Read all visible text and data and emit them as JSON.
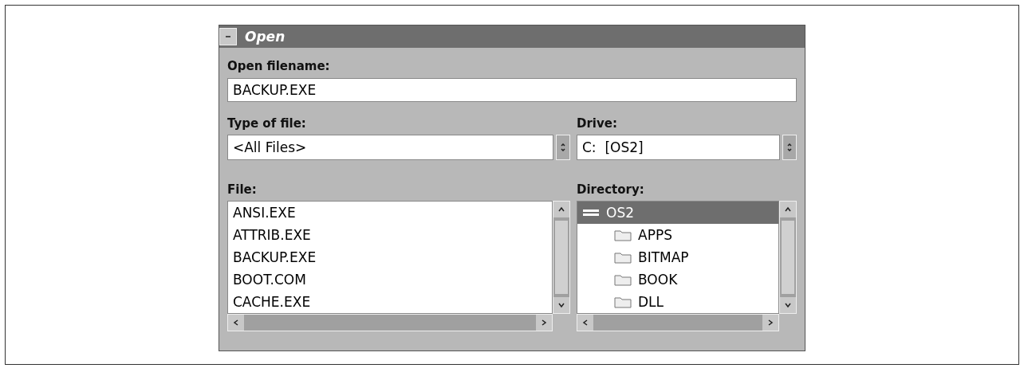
{
  "window": {
    "title": "Open"
  },
  "filename": {
    "label": "Open filename:",
    "value": "BACKUP.EXE"
  },
  "type_of_file": {
    "label": "Type of file:",
    "value": "<All Files>"
  },
  "drive": {
    "label": "Drive:",
    "value": "C:  [OS2]"
  },
  "files": {
    "label": "File:",
    "items": [
      {
        "name": "ANSI.EXE",
        "selected": false
      },
      {
        "name": "ATTRIB.EXE",
        "selected": false
      },
      {
        "name": "BACKUP.EXE",
        "selected": false
      },
      {
        "name": "BOOT.COM",
        "selected": false
      },
      {
        "name": "CACHE.EXE",
        "selected": false
      }
    ]
  },
  "directory": {
    "label": "Directory:",
    "items": [
      {
        "name": "OS2",
        "selected": true,
        "expanded": true,
        "children": [
          {
            "name": "APPS",
            "selected": false
          },
          {
            "name": "BITMAP",
            "selected": false
          },
          {
            "name": "BOOK",
            "selected": false
          },
          {
            "name": "DLL",
            "selected": false
          }
        ]
      }
    ]
  }
}
